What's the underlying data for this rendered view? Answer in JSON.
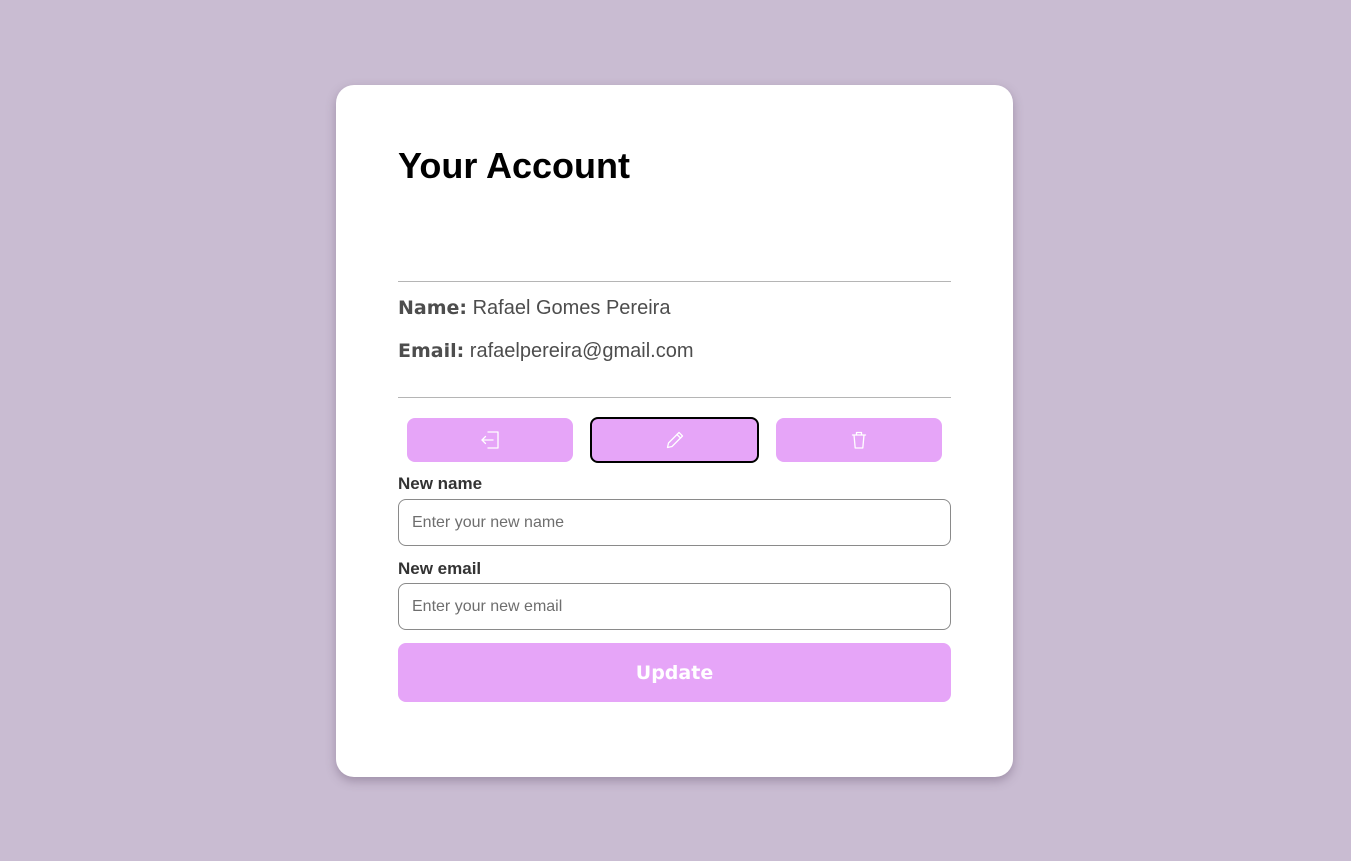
{
  "page": {
    "background_color": "#c9bcd2",
    "accent_color": "#e6a5f8"
  },
  "account": {
    "title": "Your Account",
    "name_label": "Name:",
    "name_value": "Rafael Gomes Pereira",
    "email_label": "Email:",
    "email_value": "rafaelpereira@gmail.com"
  },
  "actions": [
    {
      "icon": "logout-icon"
    },
    {
      "icon": "pencil-icon",
      "selected": true
    },
    {
      "icon": "trash-icon"
    }
  ],
  "form": {
    "name_label": "New name",
    "name_placeholder": "Enter your new name",
    "name_value": "",
    "email_label": "New email",
    "email_placeholder": "Enter your new email",
    "email_value": "",
    "submit_label": "Update"
  }
}
